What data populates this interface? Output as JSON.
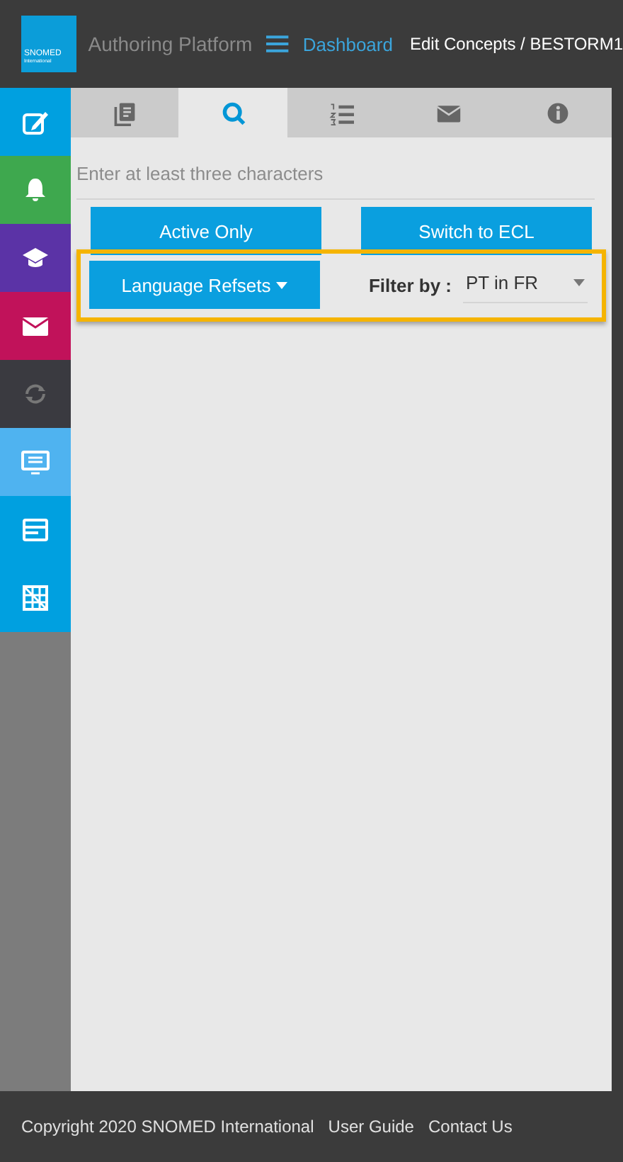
{
  "header": {
    "logo": [
      "SNOMED",
      "International"
    ],
    "title": "Authoring Platform",
    "nav_link": "Dashboard",
    "breadcrumb": "Edit Concepts / BESTORM1"
  },
  "sidebar": {
    "items": [
      {
        "kind": "edit",
        "color": "#00a0e0"
      },
      {
        "kind": "bell",
        "color": "#3ea84e"
      },
      {
        "kind": "graduation",
        "color": "#5b33a6"
      },
      {
        "kind": "mail",
        "color": "#c1125a"
      },
      {
        "kind": "sync",
        "color": "#3a3a40"
      },
      {
        "kind": "list",
        "color": "#4fb3f0"
      },
      {
        "kind": "window",
        "color": "#00a0e0"
      },
      {
        "kind": "grid",
        "color": "#00a0e0"
      }
    ]
  },
  "tabs": [
    {
      "kind": "notes",
      "selected": false
    },
    {
      "kind": "search",
      "selected": true
    },
    {
      "kind": "numbered",
      "selected": false
    },
    {
      "kind": "mail",
      "selected": false
    },
    {
      "kind": "info",
      "selected": false
    }
  ],
  "search": {
    "placeholder": "Enter at least three characters"
  },
  "buttons": [
    "Active Only",
    "Switch to ECL"
  ],
  "filter_panel": {
    "highlighted": true,
    "dropdown_button": "Language Refsets",
    "filter_label": "Filter by :",
    "filter_value": "PT in FR"
  },
  "footer": {
    "copyright": "Copyright 2020 SNOMED International",
    "links": [
      "User Guide",
      "Contact Us"
    ]
  }
}
